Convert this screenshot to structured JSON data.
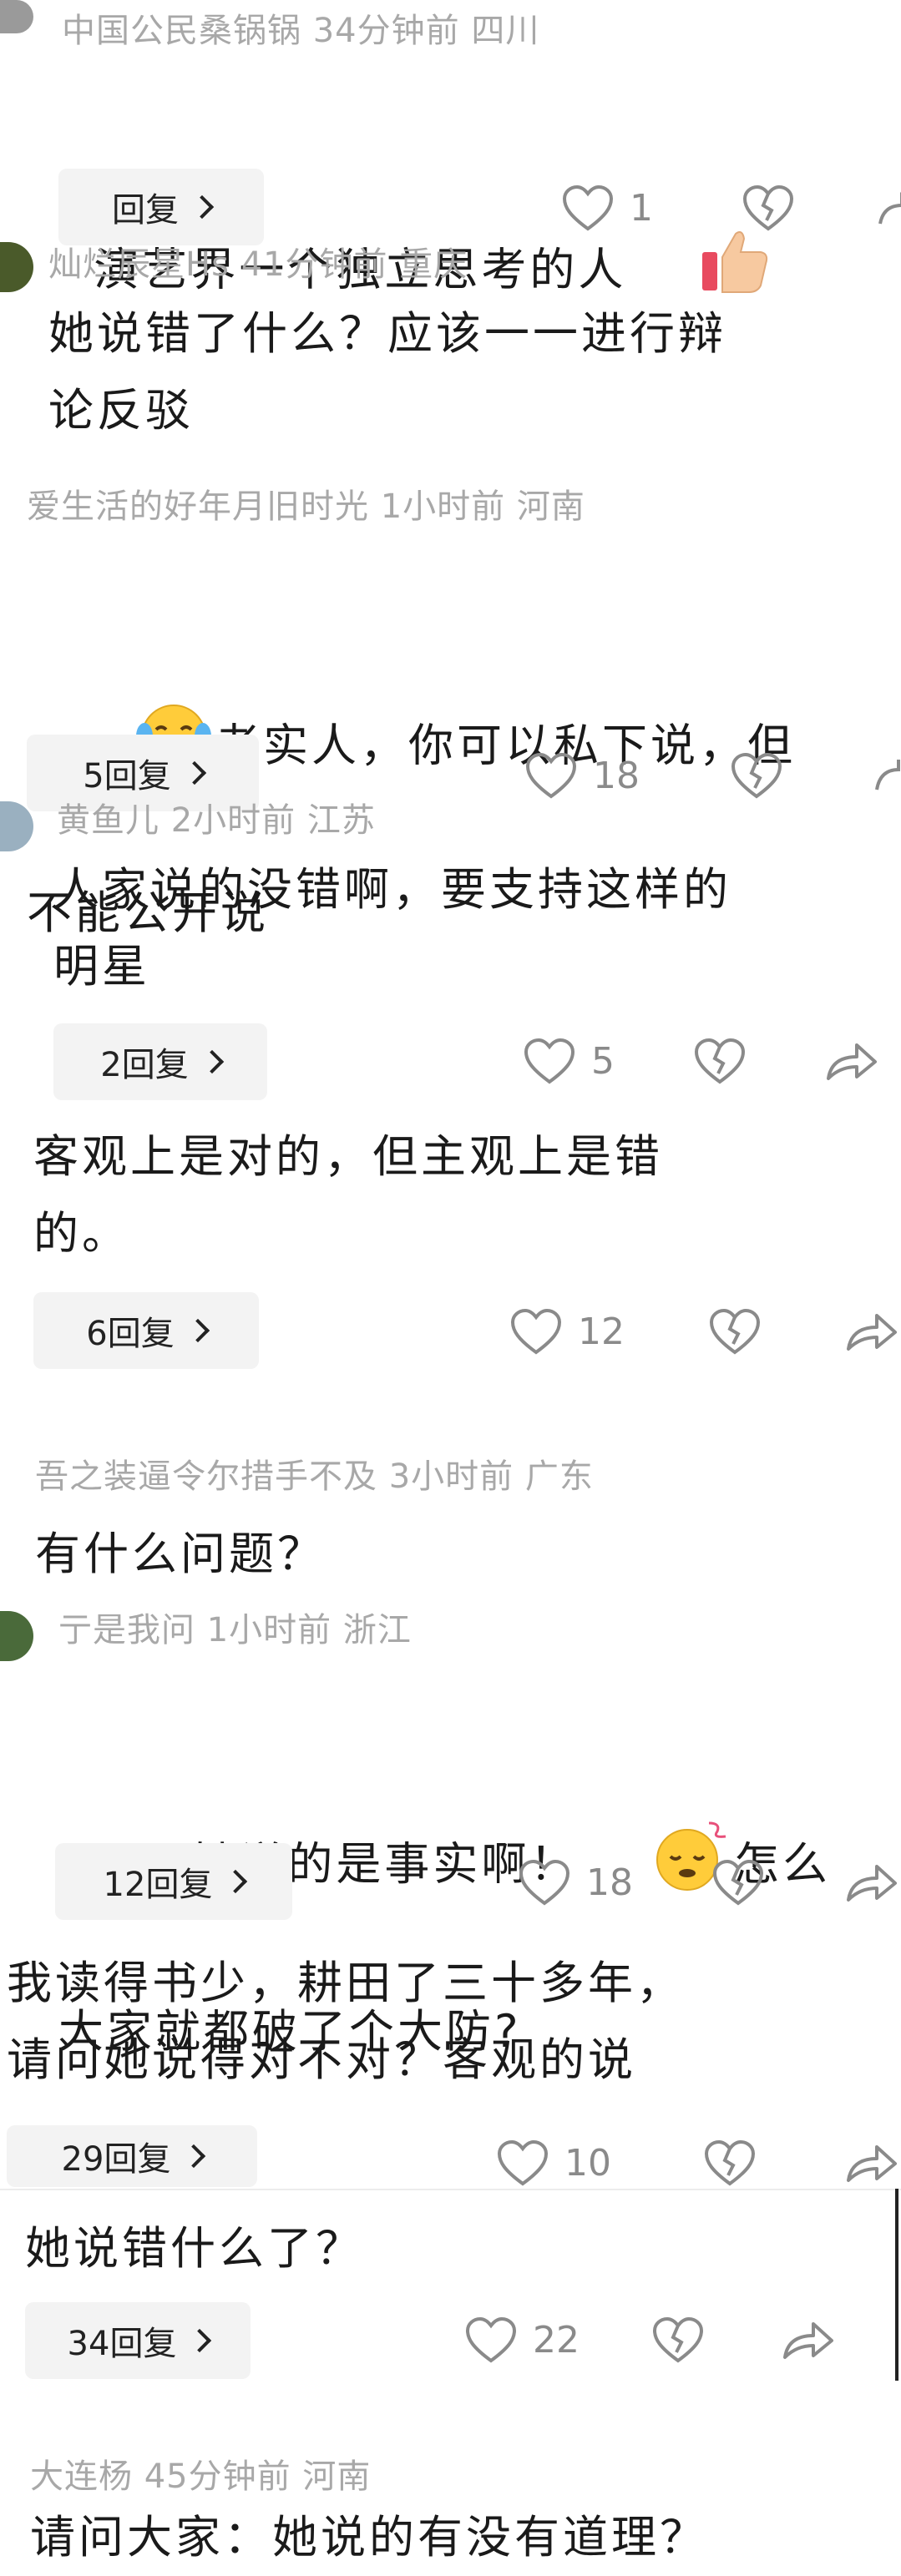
{
  "comments": [
    {
      "meta": "中国公民桑锅锅  34分钟前  四川",
      "text": "演艺界一个独立思考的人",
      "emoji": "thumbs-up-icon",
      "replies": "回复",
      "likes": "1"
    },
    {
      "meta": "灿烂辰星Hs  41分钟前  重庆",
      "text": "她说错了什么？应该一一进行辩\n论反驳"
    },
    {
      "meta": "爱生活的好年月旧时光  1小时前  河南",
      "emoji": "laughing-crying-icon",
      "text": "老实人，你可以私下说，但\n不能公开说",
      "replies": "5回复",
      "likes": "18"
    },
    {
      "meta": "黄鱼儿  2小时前  江苏",
      "text": "人家说的没错啊，要支持这样的\n明星",
      "replies": "2回复",
      "likes": "5"
    },
    {
      "text": "客观上是对的，但主观上是错\n的。",
      "replies": "6回复",
      "likes": "12"
    },
    {
      "meta": "吾之装逼令尔措手不及  3小时前  广东",
      "text": "有什么问题？"
    },
    {
      "meta": "亍是我问  1小时前  浙江",
      "text_a": "可是她说的是事实啊！",
      "emoji": "dizzy-face-icon",
      "text_b": "怎么",
      "text_c": "大家就都破了个大防?",
      "replies": "12回复",
      "likes": "18"
    },
    {
      "text": "我读得书少，耕田了三十多年，\n请问她说得对不对？客观的说",
      "replies": "29回复",
      "likes": "10"
    },
    {
      "text": "她说错什么了？",
      "replies": "34回复",
      "likes": "22"
    },
    {
      "meta": "大连杨  45分钟前  河南",
      "text": "请问大家：她说的有没有道理？"
    }
  ]
}
